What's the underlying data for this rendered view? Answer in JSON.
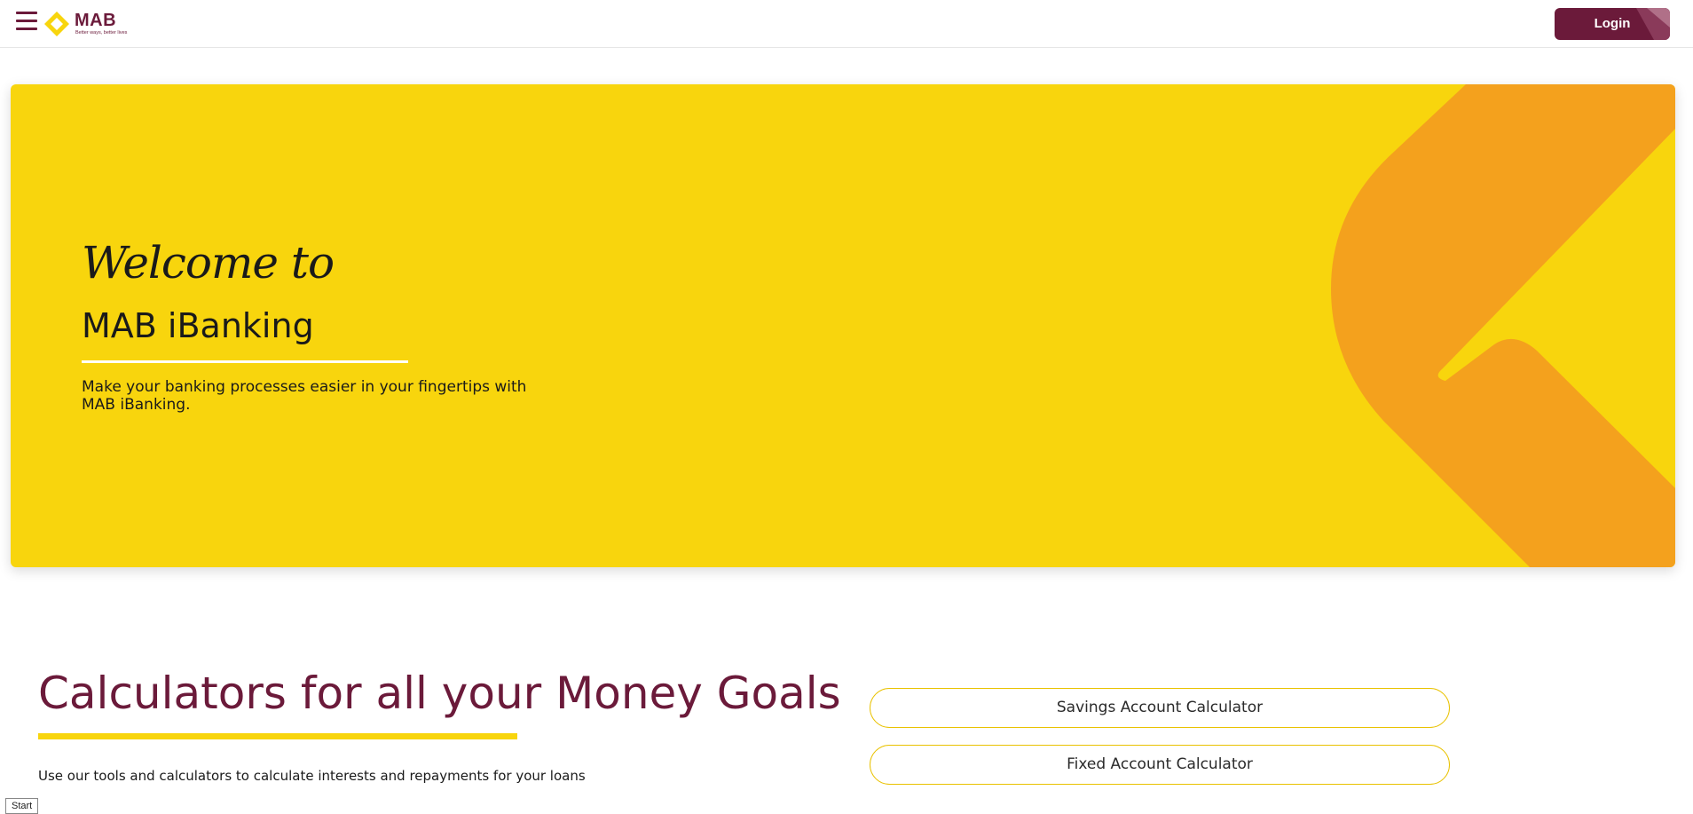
{
  "header": {
    "logo_text": "MAB",
    "logo_tagline": "Better ways, better lives",
    "login_label": "Login"
  },
  "hero": {
    "welcome": "Welcome to",
    "title": "MAB iBanking",
    "description": "Make your banking processes easier in your fingertips with MAB iBanking."
  },
  "calculators": {
    "title": "Calculators for all your Money Goals",
    "description": "Use our tools and calculators to calculate interests and repayments for your loans",
    "buttons": [
      {
        "label": "Savings Account Calculator"
      },
      {
        "label": "Fixed Account Calculator"
      }
    ]
  },
  "start_badge": "Start",
  "colors": {
    "brand_maroon": "#6b1a3a",
    "brand_yellow": "#f8d50d",
    "accent_orange": "#f4a11d"
  }
}
